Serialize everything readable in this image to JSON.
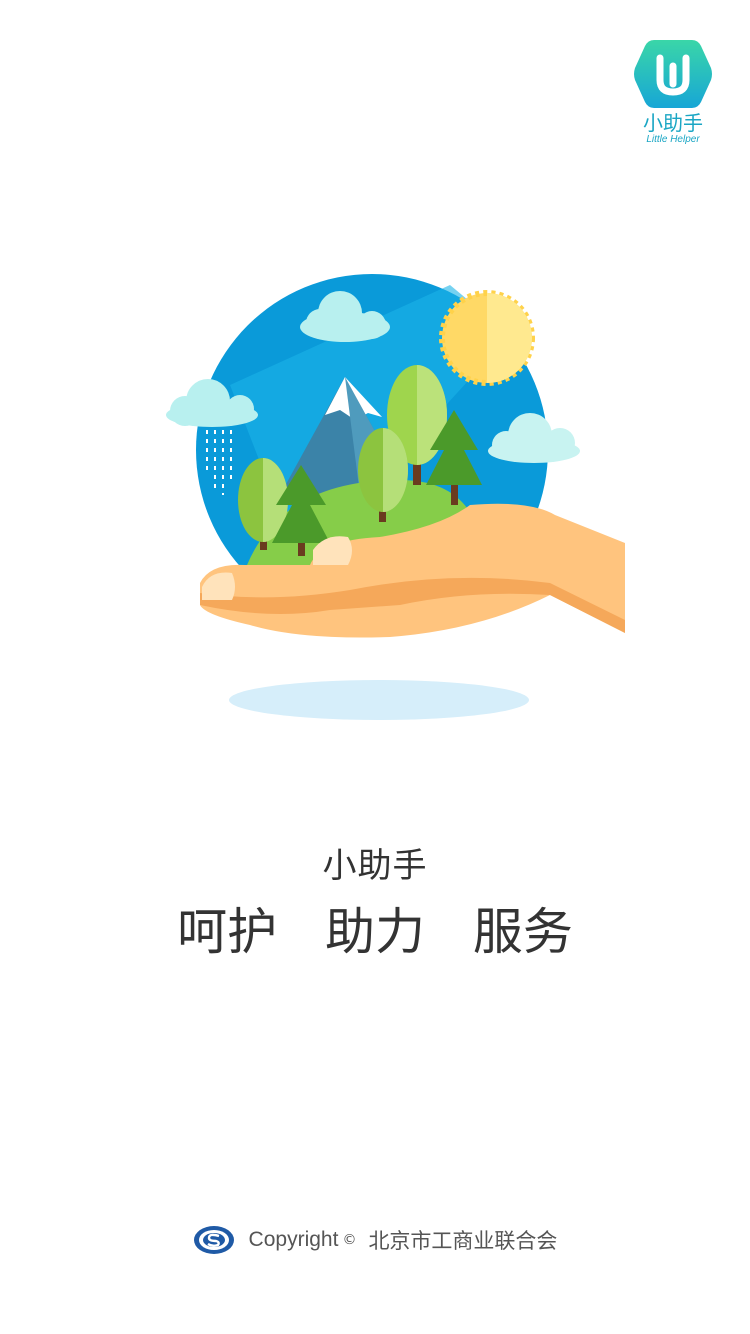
{
  "logo": {
    "title": "小助手",
    "subtitle": "Little Helper",
    "icon": "wrench-hex-icon",
    "color": "#1aa6c4"
  },
  "illustration": {
    "icon": "hand-holding-nature-illustration"
  },
  "app_name": "小助手",
  "slogan": [
    "呵护",
    "助力",
    "服务"
  ],
  "footer": {
    "copyright": "Copyright",
    "copy_mark": "©",
    "organization": "北京市工商业联合会",
    "emblem_icon": "federation-emblem-icon"
  }
}
